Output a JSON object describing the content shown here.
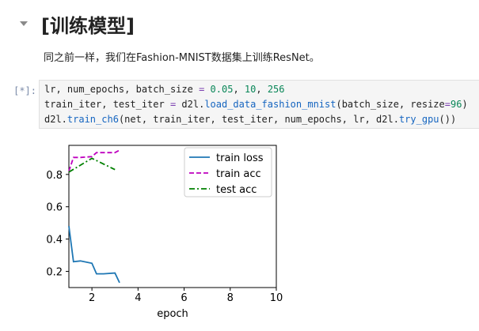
{
  "heading": {
    "text": "[训练模型]"
  },
  "description": "同之前一样，我们在Fashion-MNIST数据集上训练ResNet。",
  "cell": {
    "prompt": "[*]:",
    "lines": [
      [
        {
          "t": "lr, num_epochs, batch_size ",
          "c": ""
        },
        {
          "t": "=",
          "c": "op"
        },
        {
          "t": " ",
          "c": ""
        },
        {
          "t": "0.05",
          "c": "num"
        },
        {
          "t": ", ",
          "c": ""
        },
        {
          "t": "10",
          "c": "num"
        },
        {
          "t": ", ",
          "c": ""
        },
        {
          "t": "256",
          "c": "num"
        }
      ],
      [
        {
          "t": "train_iter, test_iter ",
          "c": ""
        },
        {
          "t": "=",
          "c": "op"
        },
        {
          "t": " d2l.",
          "c": ""
        },
        {
          "t": "load_data_fashion_mnist",
          "c": "fn"
        },
        {
          "t": "(batch_size, resize",
          "c": ""
        },
        {
          "t": "=",
          "c": "op"
        },
        {
          "t": "96",
          "c": "num"
        },
        {
          "t": ")",
          "c": ""
        }
      ],
      [
        {
          "t": "d2l.",
          "c": ""
        },
        {
          "t": "train_ch6",
          "c": "fn"
        },
        {
          "t": "(net, train_iter, test_iter, num_epochs, lr, d2l.",
          "c": ""
        },
        {
          "t": "try_gpu",
          "c": "fn"
        },
        {
          "t": "())",
          "c": ""
        }
      ]
    ]
  },
  "chart_data": {
    "type": "line",
    "xlabel": "epoch",
    "xlim": [
      1,
      10
    ],
    "ylim": [
      0.1,
      0.98
    ],
    "xticks": [
      2,
      4,
      6,
      8,
      10
    ],
    "yticks": [
      0.2,
      0.4,
      0.6,
      0.8
    ],
    "legend_position": "top-right",
    "series": [
      {
        "name": "train loss",
        "color": "#1f77b4",
        "dash": "solid",
        "x": [
          1.0,
          1.2,
          1.5,
          2.0,
          2.2,
          2.5,
          3.0,
          3.2
        ],
        "y": [
          0.48,
          0.26,
          0.265,
          0.25,
          0.185,
          0.185,
          0.19,
          0.13
        ]
      },
      {
        "name": "train acc",
        "color": "#bf00bf",
        "dash": "dashed",
        "x": [
          1.0,
          1.2,
          1.5,
          2.0,
          2.2,
          2.5,
          3.0,
          3.2
        ],
        "y": [
          0.82,
          0.905,
          0.905,
          0.91,
          0.935,
          0.935,
          0.935,
          0.95
        ]
      },
      {
        "name": "test acc",
        "color": "#008000",
        "dash": "dashdot",
        "x": [
          1.0,
          2.0,
          3.0
        ],
        "y": [
          0.815,
          0.9,
          0.83
        ]
      }
    ]
  }
}
